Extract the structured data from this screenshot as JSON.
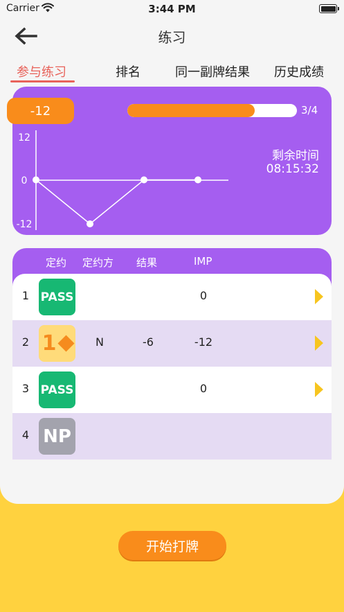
{
  "status_bar": {
    "carrier": "Carrier",
    "time": "3:44 PM"
  },
  "header": {
    "title": "练习"
  },
  "tabs": [
    {
      "label": "参与练习",
      "active": true
    },
    {
      "label": "排名",
      "active": false
    },
    {
      "label": "同一副牌结果",
      "active": false
    },
    {
      "label": "历史成绩",
      "active": false
    }
  ],
  "summary": {
    "score": "-12",
    "progress_text": "3/4",
    "progress_fraction": 0.75,
    "remaining_label": "剩余时间",
    "remaining_time": "08:15:32"
  },
  "chart_data": {
    "type": "line",
    "x": [
      1,
      2,
      3,
      4
    ],
    "values": [
      0,
      -12,
      0,
      0
    ],
    "ytick_labels": [
      "12",
      "0",
      "-12"
    ],
    "ylim": [
      -12,
      12
    ]
  },
  "table": {
    "columns": [
      "定约",
      "定约方",
      "结果",
      "IMP"
    ],
    "rows": [
      {
        "num": "1",
        "contract": "PASS",
        "declarer": "",
        "result": "",
        "imp": "0"
      },
      {
        "num": "2",
        "contract_level": "1",
        "contract_suit": "diamond-icon",
        "declarer": "N",
        "result": "-6",
        "imp": "-12"
      },
      {
        "num": "3",
        "contract": "PASS",
        "declarer": "",
        "result": "",
        "imp": "0"
      },
      {
        "num": "4",
        "contract": "NP",
        "declarer": "",
        "result": "",
        "imp": ""
      }
    ]
  },
  "footer": {
    "start_button": "开始打牌"
  },
  "colors": {
    "purple": "#a55ef0",
    "orange": "#f98c1b",
    "yellow": "#ffd23f",
    "green": "#17b873",
    "tab_active": "#e8625a"
  }
}
